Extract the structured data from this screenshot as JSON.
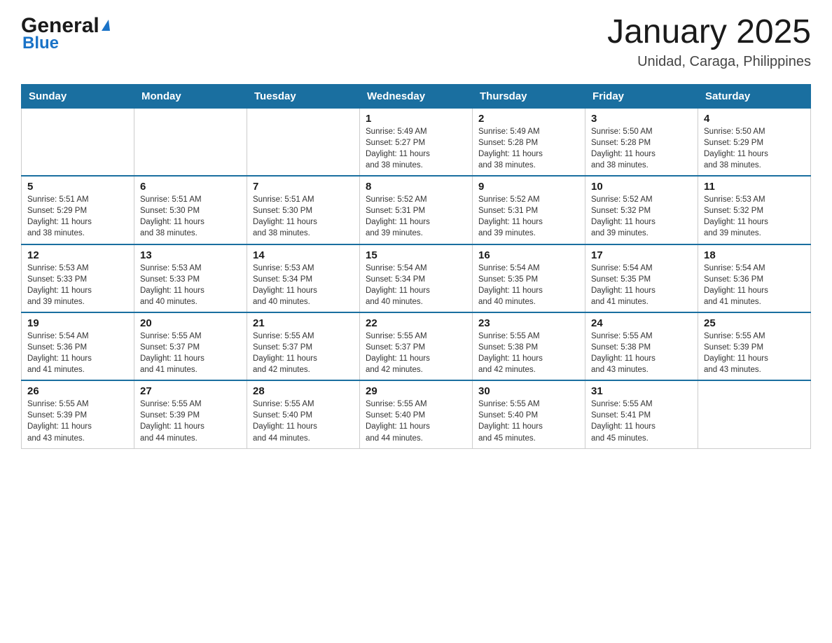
{
  "header": {
    "logo_general": "General",
    "logo_blue": "Blue",
    "month_title": "January 2025",
    "location": "Unidad, Caraga, Philippines"
  },
  "columns": [
    "Sunday",
    "Monday",
    "Tuesday",
    "Wednesday",
    "Thursday",
    "Friday",
    "Saturday"
  ],
  "weeks": [
    {
      "days": [
        {
          "num": "",
          "info": ""
        },
        {
          "num": "",
          "info": ""
        },
        {
          "num": "",
          "info": ""
        },
        {
          "num": "1",
          "info": "Sunrise: 5:49 AM\nSunset: 5:27 PM\nDaylight: 11 hours\nand 38 minutes."
        },
        {
          "num": "2",
          "info": "Sunrise: 5:49 AM\nSunset: 5:28 PM\nDaylight: 11 hours\nand 38 minutes."
        },
        {
          "num": "3",
          "info": "Sunrise: 5:50 AM\nSunset: 5:28 PM\nDaylight: 11 hours\nand 38 minutes."
        },
        {
          "num": "4",
          "info": "Sunrise: 5:50 AM\nSunset: 5:29 PM\nDaylight: 11 hours\nand 38 minutes."
        }
      ]
    },
    {
      "days": [
        {
          "num": "5",
          "info": "Sunrise: 5:51 AM\nSunset: 5:29 PM\nDaylight: 11 hours\nand 38 minutes."
        },
        {
          "num": "6",
          "info": "Sunrise: 5:51 AM\nSunset: 5:30 PM\nDaylight: 11 hours\nand 38 minutes."
        },
        {
          "num": "7",
          "info": "Sunrise: 5:51 AM\nSunset: 5:30 PM\nDaylight: 11 hours\nand 38 minutes."
        },
        {
          "num": "8",
          "info": "Sunrise: 5:52 AM\nSunset: 5:31 PM\nDaylight: 11 hours\nand 39 minutes."
        },
        {
          "num": "9",
          "info": "Sunrise: 5:52 AM\nSunset: 5:31 PM\nDaylight: 11 hours\nand 39 minutes."
        },
        {
          "num": "10",
          "info": "Sunrise: 5:52 AM\nSunset: 5:32 PM\nDaylight: 11 hours\nand 39 minutes."
        },
        {
          "num": "11",
          "info": "Sunrise: 5:53 AM\nSunset: 5:32 PM\nDaylight: 11 hours\nand 39 minutes."
        }
      ]
    },
    {
      "days": [
        {
          "num": "12",
          "info": "Sunrise: 5:53 AM\nSunset: 5:33 PM\nDaylight: 11 hours\nand 39 minutes."
        },
        {
          "num": "13",
          "info": "Sunrise: 5:53 AM\nSunset: 5:33 PM\nDaylight: 11 hours\nand 40 minutes."
        },
        {
          "num": "14",
          "info": "Sunrise: 5:53 AM\nSunset: 5:34 PM\nDaylight: 11 hours\nand 40 minutes."
        },
        {
          "num": "15",
          "info": "Sunrise: 5:54 AM\nSunset: 5:34 PM\nDaylight: 11 hours\nand 40 minutes."
        },
        {
          "num": "16",
          "info": "Sunrise: 5:54 AM\nSunset: 5:35 PM\nDaylight: 11 hours\nand 40 minutes."
        },
        {
          "num": "17",
          "info": "Sunrise: 5:54 AM\nSunset: 5:35 PM\nDaylight: 11 hours\nand 41 minutes."
        },
        {
          "num": "18",
          "info": "Sunrise: 5:54 AM\nSunset: 5:36 PM\nDaylight: 11 hours\nand 41 minutes."
        }
      ]
    },
    {
      "days": [
        {
          "num": "19",
          "info": "Sunrise: 5:54 AM\nSunset: 5:36 PM\nDaylight: 11 hours\nand 41 minutes."
        },
        {
          "num": "20",
          "info": "Sunrise: 5:55 AM\nSunset: 5:37 PM\nDaylight: 11 hours\nand 41 minutes."
        },
        {
          "num": "21",
          "info": "Sunrise: 5:55 AM\nSunset: 5:37 PM\nDaylight: 11 hours\nand 42 minutes."
        },
        {
          "num": "22",
          "info": "Sunrise: 5:55 AM\nSunset: 5:37 PM\nDaylight: 11 hours\nand 42 minutes."
        },
        {
          "num": "23",
          "info": "Sunrise: 5:55 AM\nSunset: 5:38 PM\nDaylight: 11 hours\nand 42 minutes."
        },
        {
          "num": "24",
          "info": "Sunrise: 5:55 AM\nSunset: 5:38 PM\nDaylight: 11 hours\nand 43 minutes."
        },
        {
          "num": "25",
          "info": "Sunrise: 5:55 AM\nSunset: 5:39 PM\nDaylight: 11 hours\nand 43 minutes."
        }
      ]
    },
    {
      "days": [
        {
          "num": "26",
          "info": "Sunrise: 5:55 AM\nSunset: 5:39 PM\nDaylight: 11 hours\nand 43 minutes."
        },
        {
          "num": "27",
          "info": "Sunrise: 5:55 AM\nSunset: 5:39 PM\nDaylight: 11 hours\nand 44 minutes."
        },
        {
          "num": "28",
          "info": "Sunrise: 5:55 AM\nSunset: 5:40 PM\nDaylight: 11 hours\nand 44 minutes."
        },
        {
          "num": "29",
          "info": "Sunrise: 5:55 AM\nSunset: 5:40 PM\nDaylight: 11 hours\nand 44 minutes."
        },
        {
          "num": "30",
          "info": "Sunrise: 5:55 AM\nSunset: 5:40 PM\nDaylight: 11 hours\nand 45 minutes."
        },
        {
          "num": "31",
          "info": "Sunrise: 5:55 AM\nSunset: 5:41 PM\nDaylight: 11 hours\nand 45 minutes."
        },
        {
          "num": "",
          "info": ""
        }
      ]
    }
  ]
}
